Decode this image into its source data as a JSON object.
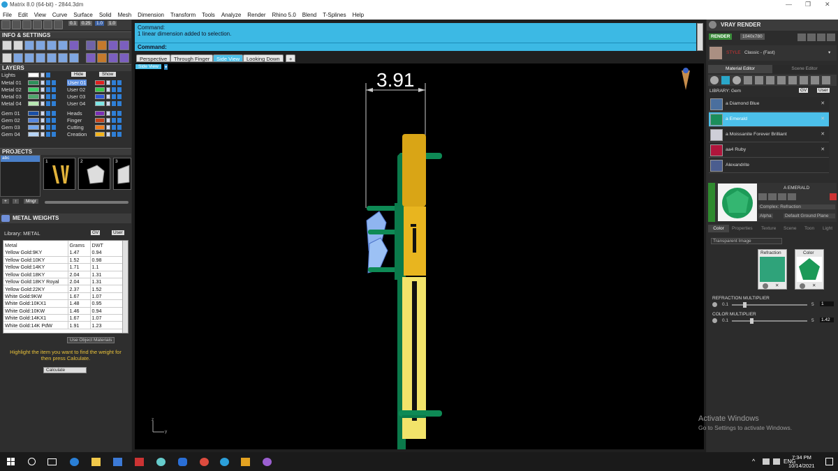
{
  "title_bar": {
    "title": "Matrix 8.0 (64-bit) - 2844.3dm",
    "min": "—",
    "max": "❐",
    "close": "✕"
  },
  "menu": [
    "File",
    "Edit",
    "View",
    "Curve",
    "Surface",
    "Solid",
    "Mesh",
    "Dimension",
    "Transform",
    "Tools",
    "Analyze",
    "Render",
    "Rhino 5.0",
    "Blend",
    "T-Splines",
    "Help"
  ],
  "toolbar": {
    "val1": "0.1",
    "val2": "0.25",
    "val3": "1.0"
  },
  "info_settings": {
    "header": "INFO & SETTINGS"
  },
  "layers": {
    "header": "LAYERS",
    "lights": "Lights",
    "hide": "Hide",
    "show": "Show",
    "left": [
      {
        "name": "Metal 01",
        "color": "#2e8f5a"
      },
      {
        "name": "Metal 02",
        "color": "#3fcf6a"
      },
      {
        "name": "Metal 03",
        "color": "#4fa86c"
      },
      {
        "name": "Metal 04",
        "color": "#b7e8b2"
      },
      {
        "name": "Gem 01",
        "color": "#1a4fa5"
      },
      {
        "name": "Gem 02",
        "color": "#5586e0"
      },
      {
        "name": "Gem 03",
        "color": "#74a7ef"
      },
      {
        "name": "Gem 04",
        "color": "#b6d4f6"
      }
    ],
    "right": [
      {
        "name": "User 01",
        "color": "#e02020"
      },
      {
        "name": "User 02",
        "color": "#3ac74a"
      },
      {
        "name": "User 03",
        "color": "#2c58d8"
      },
      {
        "name": "User 04",
        "color": "#7de6e6"
      },
      {
        "name": "Heads",
        "color": "#7b2fb5"
      },
      {
        "name": "Finger",
        "color": "#c4431b"
      },
      {
        "name": "Cutting",
        "color": "#f07c1b"
      },
      {
        "name": "Creation",
        "color": "#f3b41c"
      }
    ]
  },
  "projects": {
    "header": "PROJECTS",
    "item": "abc",
    "thumbs": [
      "1",
      "2",
      "3"
    ],
    "mngr": "Mngr"
  },
  "metal_weights": {
    "header": "METAL WEIGHTS",
    "library": "Library: METAL",
    "gv": "GV",
    "user": "User",
    "columns": [
      "Metal",
      "Grams",
      "DWT"
    ],
    "rows": [
      [
        "Yellow Gold:9KY",
        "1.47",
        "0.94"
      ],
      [
        "Yellow Gold:10KY",
        "1.52",
        "0.98"
      ],
      [
        "Yellow Gold:14KY",
        "1.71",
        "1.1"
      ],
      [
        "Yellow Gold:18KY",
        "2.04",
        "1.31"
      ],
      [
        "Yellow Gold:18KY Royal",
        "2.04",
        "1.31"
      ],
      [
        "Yellow Gold:22KY",
        "2.37",
        "1.52"
      ],
      [
        "White Gold:9KW",
        "1.67",
        "1.07"
      ],
      [
        "White Gold:10KX1",
        "1.48",
        "0.95"
      ],
      [
        "White Gold:10KW",
        "1.46",
        "0.94"
      ],
      [
        "White Gold:14KX1",
        "1.67",
        "1.07"
      ],
      [
        "White Gold:14K PdW",
        "1.91",
        "1.23"
      ]
    ],
    "use_obj": "Use Object Materials",
    "hint": "Highlight the item you want to find the weight for then press Calculate.",
    "calculate": "Calculate"
  },
  "command": {
    "label": "Command:",
    "line": "1 linear dimension added to selection.",
    "prompt": "Command:"
  },
  "view_tabs": [
    "Perspective",
    "Through Finger",
    "Side View",
    "Looking Down"
  ],
  "view_label": "Side View",
  "viewport": {
    "dimension": "3.91",
    "axis_z": "z",
    "axis_y": "y"
  },
  "vray": {
    "header": "VRAY RENDER",
    "render_btn": "RENDER",
    "res": "1040x780",
    "style_label": "STYLE",
    "style": "Classic - (Fast)",
    "tabs": [
      "Material Editor",
      "Scene Editor"
    ],
    "library": "LIBRARY: Gem",
    "gv": "GV",
    "user": "User",
    "materials": [
      {
        "name": "a Diamond Blue",
        "color": "#4a6f9e"
      },
      {
        "name": "a Emerald",
        "color": "#1b8e5b"
      },
      {
        "name": "a Moissanite Forever Brilliant",
        "color": "#cfcfd8"
      },
      {
        "name": "aa4 Ruby",
        "color": "#b0153b"
      },
      {
        "name": "Alexandrite",
        "color": "#4b5d8f"
      }
    ],
    "selected_material": "A EMERALD",
    "complex": "Complex: Refraction",
    "alpha": "Alpha",
    "ground": "Default Ground Plane",
    "prop_tabs": [
      "Color",
      "Properties",
      "Texture",
      "Scene",
      "Toon",
      "Light"
    ],
    "transparent": "Transparent Image",
    "refraction": "Refraction",
    "color": "Color",
    "refraction_mult": {
      "label": "REFRACTION MULTIPLIER",
      "min": "0.1",
      "max": "5",
      "value": "1"
    },
    "color_mult": {
      "label": "COLOR MULTIPLIER",
      "min": "0.1",
      "max": "5",
      "value": "1.42"
    }
  },
  "watermark": {
    "line1": "Activate Windows",
    "line2": "Go to Settings to activate Windows."
  },
  "taskbar": {
    "lang": "ENG",
    "time": "7:34 PM",
    "date": "10/14/2021"
  }
}
